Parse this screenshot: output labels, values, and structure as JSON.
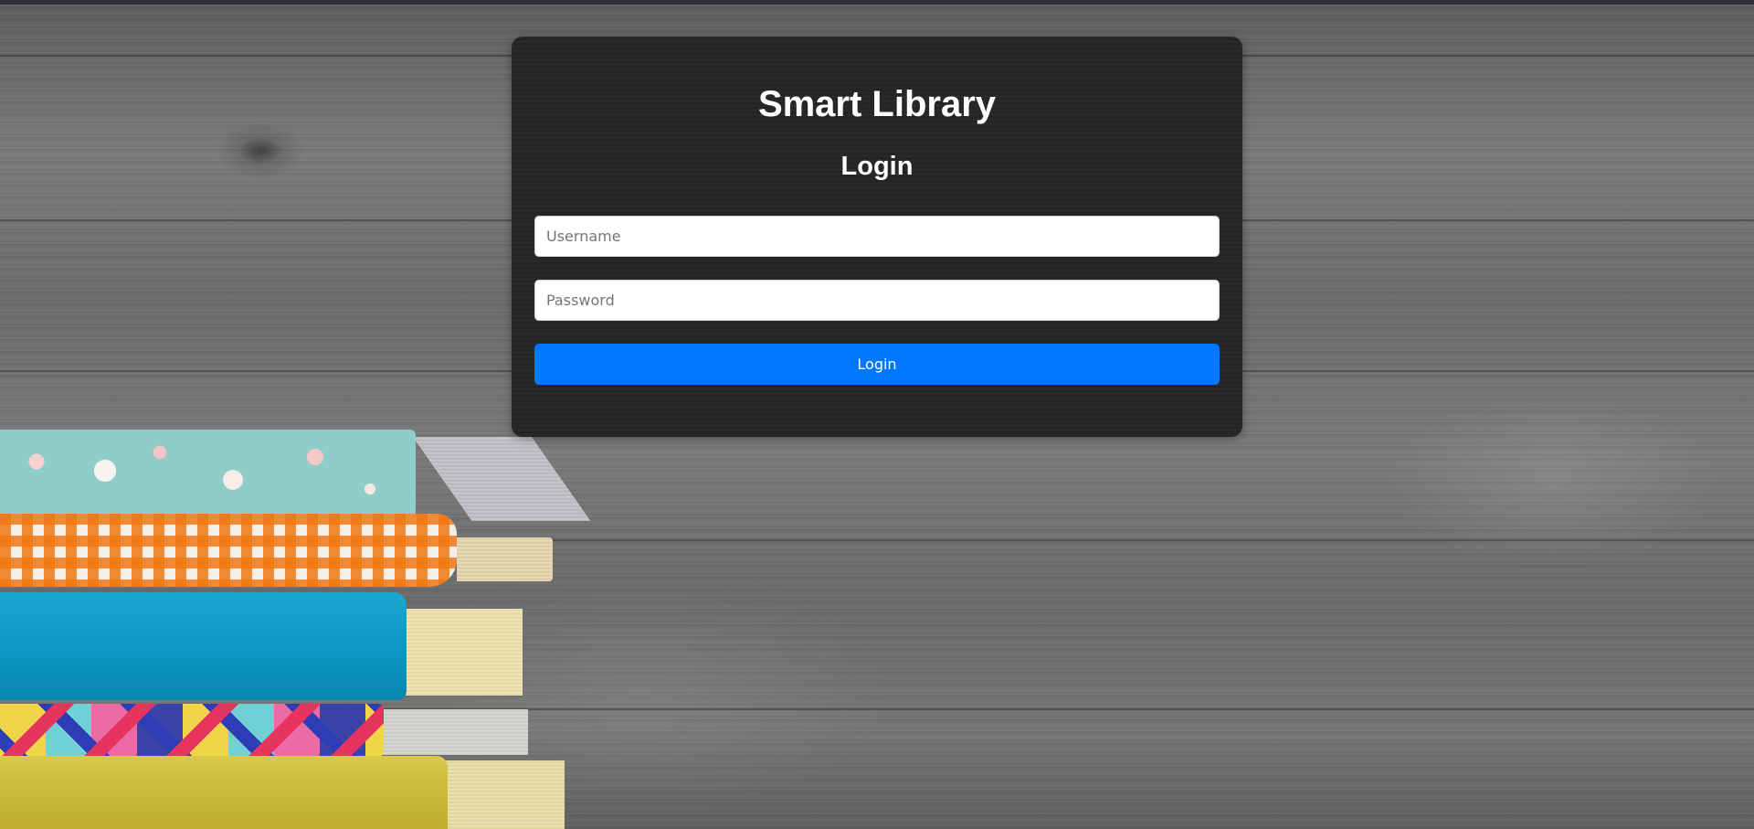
{
  "app": {
    "title": "Smart Library"
  },
  "login_form": {
    "heading": "Login",
    "username_placeholder": "Username",
    "username_value": "",
    "password_placeholder": "Password",
    "password_value": "",
    "submit_label": "Login"
  },
  "colors": {
    "panel_background": "#262626",
    "button_background": "#0077ff",
    "text": "#ffffff"
  }
}
